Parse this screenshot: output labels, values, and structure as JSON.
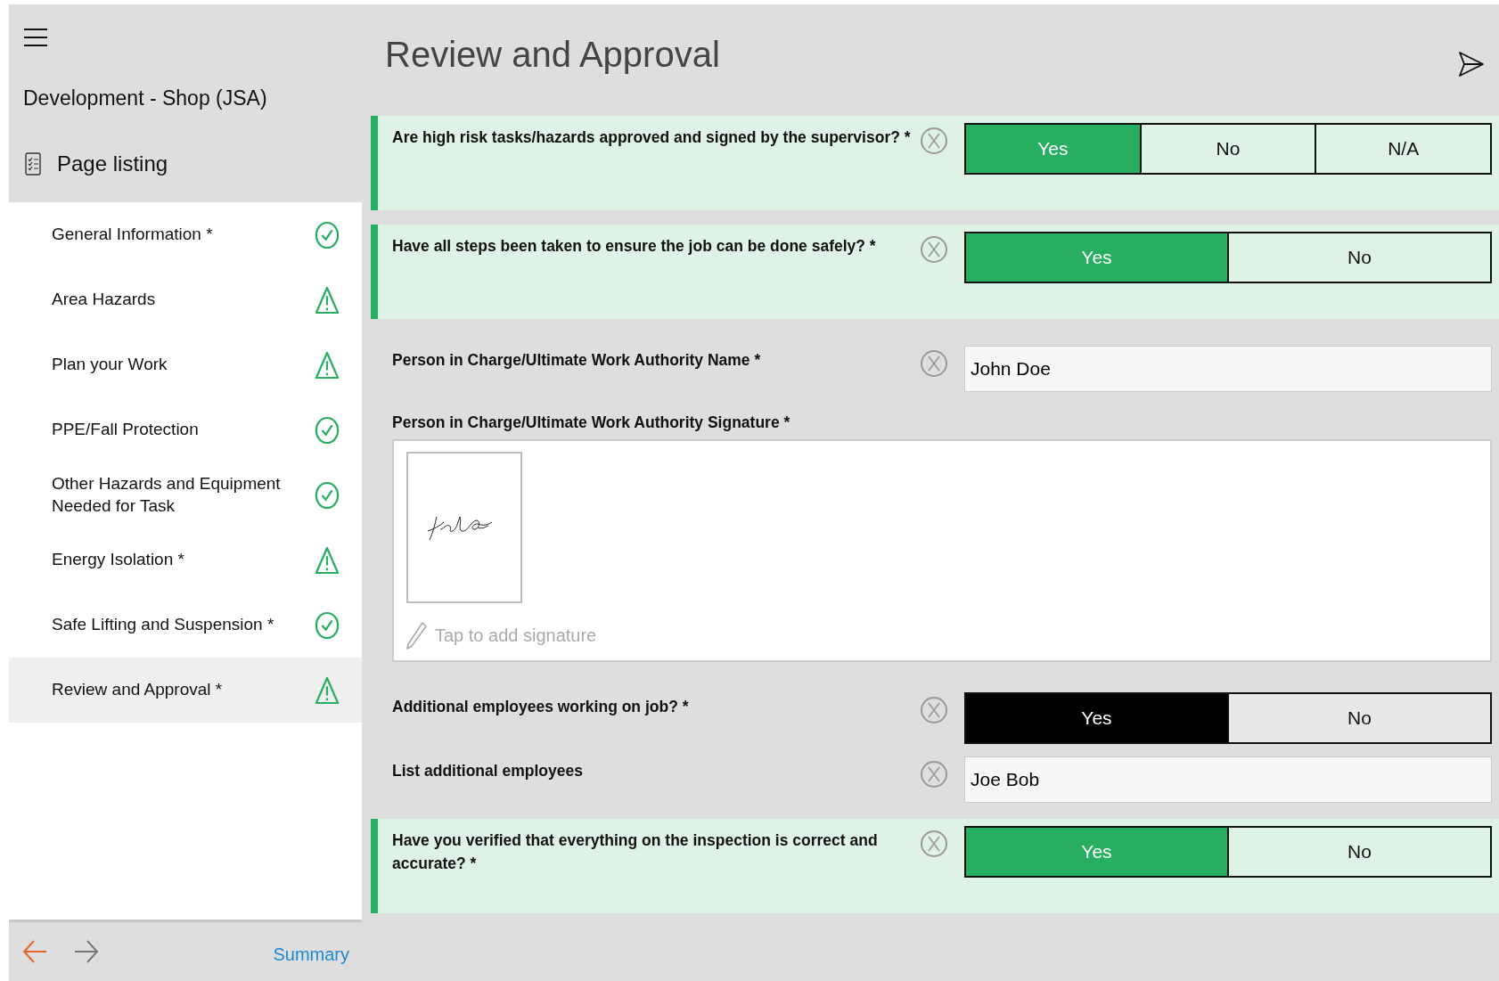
{
  "sidebar": {
    "title": "Development - Shop (JSA)",
    "section": "Page listing",
    "items": [
      {
        "label": "General Information *",
        "complete": true,
        "selected": false
      },
      {
        "label": "Area Hazards",
        "complete": false,
        "selected": false
      },
      {
        "label": "Plan your Work",
        "complete": false,
        "selected": false
      },
      {
        "label": "PPE/Fall Protection",
        "complete": true,
        "selected": false
      },
      {
        "label": "Other Hazards and Equipment Needed for Task",
        "complete": true,
        "selected": false
      },
      {
        "label": "Energy Isolation *",
        "complete": false,
        "selected": false
      },
      {
        "label": "Safe Lifting and Suspension *",
        "complete": true,
        "selected": false
      },
      {
        "label": "Review and Approval *",
        "complete": false,
        "selected": true
      }
    ],
    "footer": {
      "summary": "Summary"
    }
  },
  "page": {
    "title": "Review and Approval",
    "questions": [
      {
        "kind": "choice",
        "label": "Are high risk tasks/hazards approved and signed by the supervisor? *",
        "highlighted": true,
        "options": [
          {
            "label": "Yes",
            "selected": true
          },
          {
            "label": "No",
            "selected": false
          },
          {
            "label": "N/A",
            "selected": false
          }
        ]
      },
      {
        "kind": "choice",
        "label": "Have all steps been taken to ensure the job can be done safely? *",
        "highlighted": true,
        "options": [
          {
            "label": "Yes",
            "selected": true
          },
          {
            "label": "No",
            "selected": false
          }
        ]
      },
      {
        "kind": "text",
        "label": "Person in Charge/Ultimate Work Authority Name *",
        "value": "John Doe"
      },
      {
        "kind": "signature",
        "label": "Person in Charge/Ultimate Work Authority Signature *",
        "placeholder": "Tap to add signature"
      },
      {
        "kind": "choice",
        "label": "Additional employees working on job? *",
        "highlighted": false,
        "options": [
          {
            "label": "Yes",
            "selected": true
          },
          {
            "label": "No",
            "selected": false
          }
        ]
      },
      {
        "kind": "text",
        "label": "List additional employees",
        "value": "Joe Bob"
      },
      {
        "kind": "choice",
        "label": "Have you verified that everything on the inspection is correct and accurate? *",
        "highlighted": true,
        "options": [
          {
            "label": "Yes",
            "selected": true
          },
          {
            "label": "No",
            "selected": false
          }
        ]
      }
    ]
  }
}
